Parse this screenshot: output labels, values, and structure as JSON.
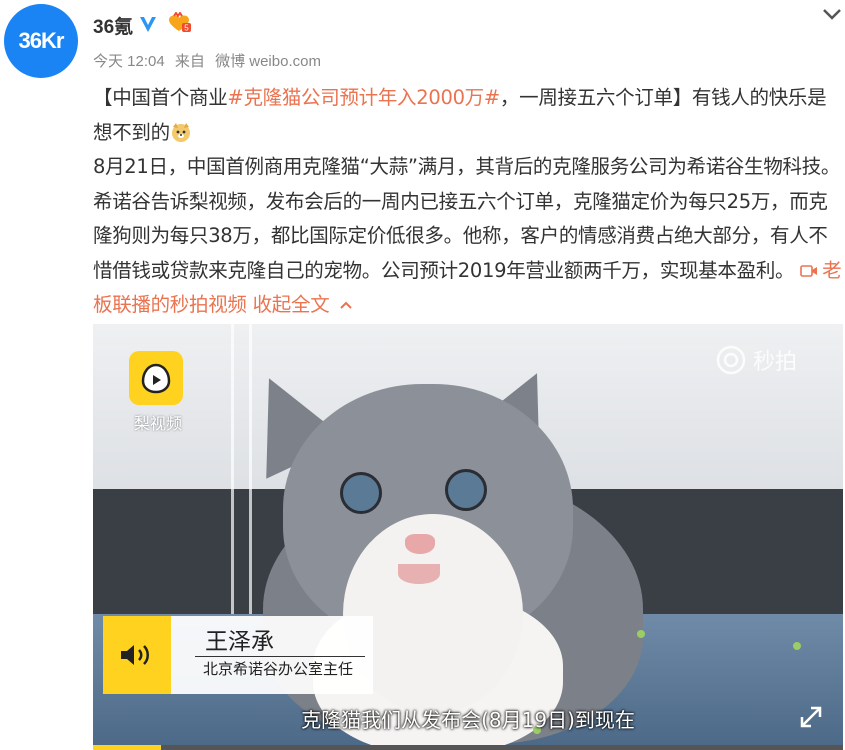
{
  "post": {
    "avatar_text": "36Kr",
    "username": "36氪",
    "time": "今天 12:04",
    "source_prefix": "来自",
    "source": "微博 weibo.com",
    "content": {
      "bracket_open": "【中国首个商业",
      "hashtag": "#克隆猫公司预计年入2000万#",
      "bracket_rest": "，一周接五六个订单】有钱人的快乐是想不到的",
      "body": "8月21日，中国首例商用克隆猫“大蒜”满月，其背后的克隆服务公司为希诺谷生物科技。希诺谷告诉梨视频，发布会后的一周内已接五六个订单，克隆猫定价为每只25万，而克隆狗则为每只38万，都比国际定价低很多。他称，客户的情感消费占绝大部分，有人不惜借钱或贷款来克隆自己的宠物。公司预计2019年营业额两千万，实现基本盈利。",
      "video_link": "老板联播的秒拍视频",
      "collapse_label": "收起全文"
    }
  },
  "video": {
    "logo_label": "梨视频",
    "watermark": "秒拍",
    "speaker_name": "王泽承",
    "speaker_title": "北京希诺谷办公室主任",
    "subtitle": "克隆猫我们从发布会(8月19日)到现在",
    "progress_fraction": 0.09
  },
  "colors": {
    "link": "#eb7350",
    "avatar_bg": "#1a84f5",
    "accent_yellow": "#ffd21f"
  },
  "icons": [
    "verified-icon",
    "member-badge-icon",
    "chevron-down-icon",
    "doge-emoji-icon",
    "video-icon",
    "chevron-up-icon",
    "pear-logo-icon",
    "miaopai-icon",
    "speaker-icon",
    "expand-icon"
  ]
}
